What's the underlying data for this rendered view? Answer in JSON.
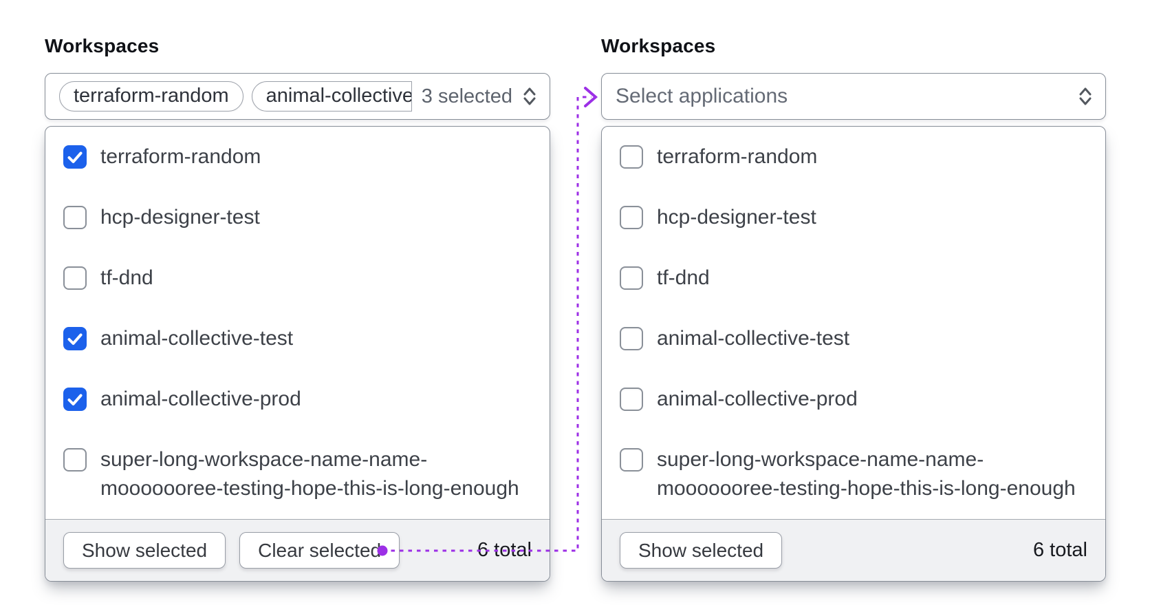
{
  "colors": {
    "checkbox_checked": "#1c61eb",
    "border_gray": "#868d97",
    "footer_bg": "#f0f1f3"
  },
  "annotation": {
    "color": "#9c2fe6",
    "style": "dashed-arrow-from-clear-selected-to-right-trigger"
  },
  "icons": {
    "trigger": "caret-up-down-icon",
    "checkbox": "check-icon",
    "annotation_start": "dot",
    "annotation_end": "arrowhead-right"
  },
  "panels": [
    {
      "label": "Workspaces",
      "trigger": {
        "tags": [
          {
            "label": "terraform-random",
            "truncated": false
          },
          {
            "label": "animal-collective",
            "truncated": true
          }
        ],
        "selected_count_text": "3 selected"
      },
      "options": [
        {
          "label": "terraform-random",
          "checked": true
        },
        {
          "label": "hcp-designer-test",
          "checked": false
        },
        {
          "label": "tf-dnd",
          "checked": false
        },
        {
          "label": "animal-collective-test",
          "checked": true
        },
        {
          "label": "animal-collective-prod",
          "checked": true
        },
        {
          "label": "super-long-workspace-name-name-mooooooree-testing-hope-this-is-long-enough",
          "checked": false
        }
      ],
      "footer": {
        "buttons": [
          {
            "label": "Show selected"
          },
          {
            "label": "Clear selected"
          }
        ],
        "total_text": "6 total"
      }
    },
    {
      "label": "Workspaces",
      "trigger": {
        "tags": [],
        "placeholder": "Select applications"
      },
      "options": [
        {
          "label": "terraform-random",
          "checked": false
        },
        {
          "label": "hcp-designer-test",
          "checked": false
        },
        {
          "label": "tf-dnd",
          "checked": false
        },
        {
          "label": "animal-collective-test",
          "checked": false
        },
        {
          "label": "animal-collective-prod",
          "checked": false
        },
        {
          "label": "super-long-workspace-name-name-mooooooree-testing-hope-this-is-long-enough",
          "checked": false
        }
      ],
      "footer": {
        "buttons": [
          {
            "label": "Show selected"
          }
        ],
        "total_text": "6 total"
      }
    }
  ]
}
